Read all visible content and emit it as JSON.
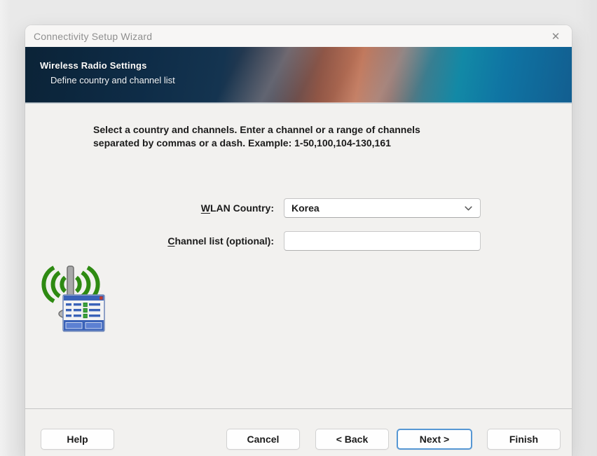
{
  "window": {
    "title": "Connectivity Setup Wizard",
    "close_glyph": "✕"
  },
  "banner": {
    "title": "Wireless Radio Settings",
    "subtitle": "Define country and channel list"
  },
  "instructions": {
    "line1": "Select a country and channels. Enter a channel or a range of channels",
    "line2": "separated by commas or a dash. Example: 1-50,100,104-130,161"
  },
  "form": {
    "wlan_country": {
      "label_accesskey": "W",
      "label_rest": "LAN Country:",
      "value": "Korea"
    },
    "channel_list": {
      "label_accesskey": "C",
      "label_rest": "hannel list (optional):",
      "value": "",
      "placeholder": ""
    }
  },
  "buttons": {
    "help": "Help",
    "cancel": "Cancel",
    "back": "< Back",
    "next": "Next >",
    "finish": "Finish"
  },
  "icons": {
    "wireless_radio": "wireless-radio-icon",
    "chevron_down": "chevron-down-icon",
    "close": "close-icon"
  },
  "colors": {
    "banner_navy": "#0e2c47",
    "banner_orange": "#c0765a",
    "banner_teal": "#1289a6",
    "focus_accent": "#5697d4",
    "wave_green": "#2e8a12",
    "mini_window_blue": "#3a62b8",
    "content_bg": "#f2f1ef"
  }
}
